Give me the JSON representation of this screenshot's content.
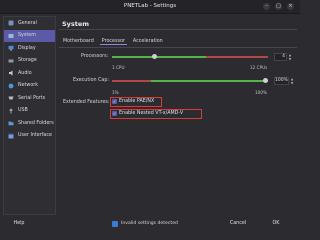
{
  "window": {
    "title": "PNETLab - Settings"
  },
  "sidebar": {
    "items": [
      {
        "label": "General",
        "icon": "general-icon",
        "active": false
      },
      {
        "label": "System",
        "icon": "system-icon",
        "active": true
      },
      {
        "label": "Display",
        "icon": "display-icon",
        "active": false
      },
      {
        "label": "Storage",
        "icon": "storage-icon",
        "active": false
      },
      {
        "label": "Audio",
        "icon": "audio-icon",
        "active": false
      },
      {
        "label": "Network",
        "icon": "network-icon",
        "active": false
      },
      {
        "label": "Serial Ports",
        "icon": "serial-ports-icon",
        "active": false
      },
      {
        "label": "USB",
        "icon": "usb-icon",
        "active": false
      },
      {
        "label": "Shared Folders",
        "icon": "shared-folders-icon",
        "active": false
      },
      {
        "label": "User Interface",
        "icon": "user-interface-icon",
        "active": false
      }
    ]
  },
  "panel": {
    "title": "System"
  },
  "tabs": [
    {
      "label": "Motherboard",
      "active": false
    },
    {
      "label": "Processor",
      "active": true
    },
    {
      "label": "Acceleration",
      "active": false
    }
  ],
  "processors": {
    "label": "Processors:",
    "value": "4",
    "min_label": "1 CPU",
    "max_label": "12 CPUs",
    "level": 0.27
  },
  "execution_cap": {
    "label": "Execution Cap:",
    "value": "100%",
    "min_label": "1%",
    "max_label": "100%",
    "level": 1.0
  },
  "extended_features": {
    "label": "Extended Features:",
    "options": [
      {
        "label": "Enable PAE/NX",
        "checked": true
      },
      {
        "label": "Enable Nested VT-x/AMD-V",
        "checked": true
      }
    ]
  },
  "footer": {
    "help": "Help",
    "status": "Invalid settings detected",
    "cancel": "Cancel",
    "ok": "OK"
  },
  "colors": {
    "accent": "#5a5aa6",
    "highlight": "#d83a3a",
    "slider_ok": "#56b34e",
    "slider_bad": "#b04848"
  }
}
